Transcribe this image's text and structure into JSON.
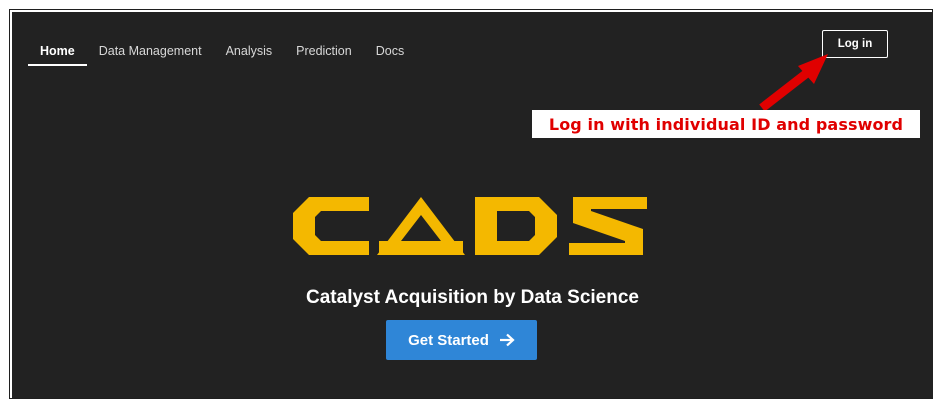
{
  "nav": {
    "items": [
      {
        "label": "Home",
        "active": true
      },
      {
        "label": "Data Management",
        "active": false
      },
      {
        "label": "Analysis",
        "active": false
      },
      {
        "label": "Prediction",
        "active": false
      },
      {
        "label": "Docs",
        "active": false
      }
    ]
  },
  "header": {
    "login_label": "Log in"
  },
  "annotation": {
    "text": "Log in with individual ID and password",
    "color": "#e00000",
    "arrow_icon": "arrow-up-right-icon"
  },
  "hero": {
    "logo_text": "CADS",
    "logo_color": "#f4b800",
    "tagline": "Catalyst Acquisition by Data Science",
    "cta_label": "Get Started",
    "cta_icon": "arrow-right-icon",
    "cta_color": "#2f86d7"
  },
  "theme": {
    "background": "#222222",
    "text": "#ffffff"
  }
}
